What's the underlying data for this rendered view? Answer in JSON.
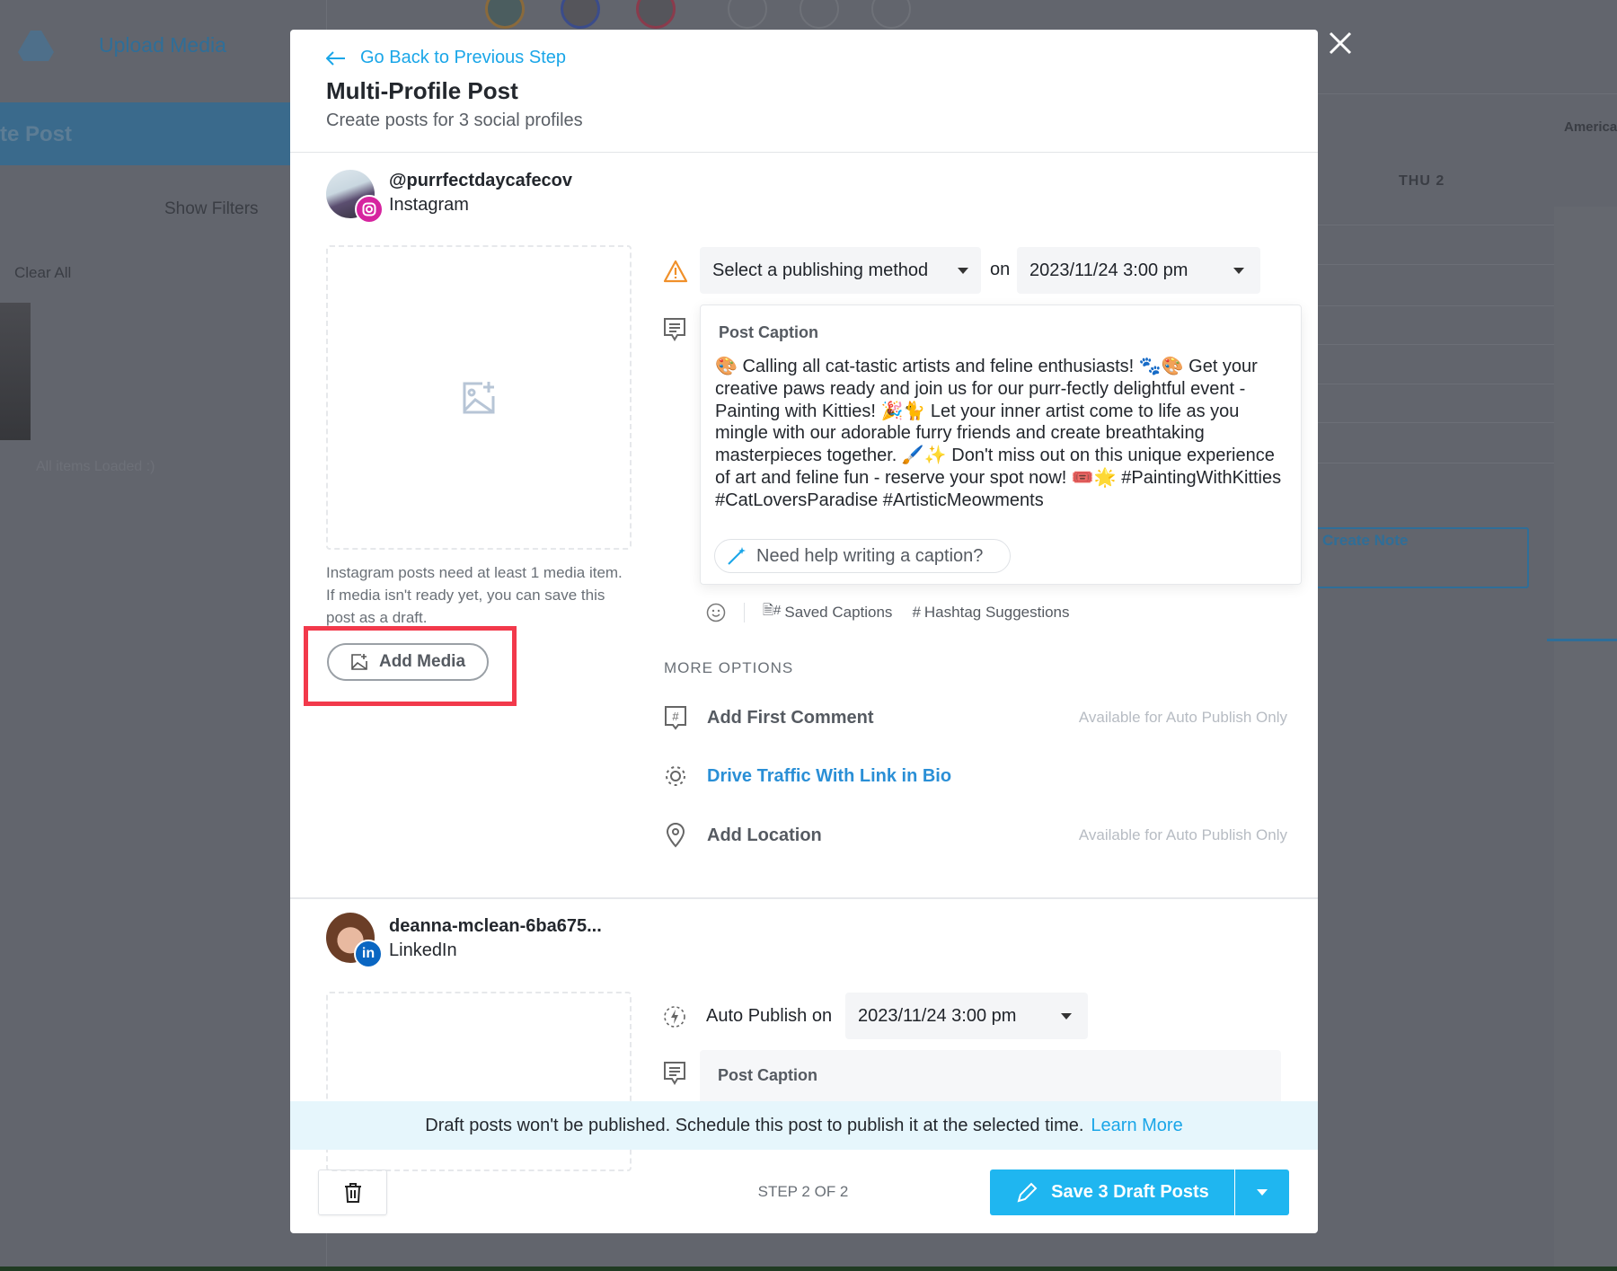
{
  "background": {
    "upload_media": "Upload Media",
    "create_post": "te Post",
    "show_filters": "Show Filters",
    "clear_all": "Clear All",
    "all_items_loaded": "All items Loaded :)",
    "day_header": "THU 2",
    "timezone": "America",
    "create_note": "Create Note"
  },
  "modal": {
    "back_link": "Go Back to Previous Step",
    "title": "Multi-Profile Post",
    "subtitle": "Create posts for 3 social profiles",
    "close_icon": "close-icon"
  },
  "profiles": [
    {
      "handle": "@purrfectdaycafecov",
      "network": "Instagram",
      "network_color": "#d6249f",
      "media_note": "Instagram posts need at least 1 media item. If media isn't ready yet, you can save this post as a draft.",
      "add_media": "Add Media",
      "publishing_method": "Select a publishing method",
      "on_label": "on",
      "datetime": "2023/11/24 3:00 pm",
      "caption_label": "Post Caption",
      "caption": "🎨 Calling all cat-tastic artists and feline enthusiasts! 🐾🎨 Get your creative paws ready and join us for our purr-fectly delightful event - Painting with Kitties! 🎉🐈 Let your inner artist come to life as you mingle with our adorable furry friends and create breathtaking masterpieces together. 🖌️✨ Don't miss out on this unique experience of art and feline fun - reserve your spot now! 🎟️🌟 #PaintingWithKitties #CatLoversParadise #ArtisticMeowments",
      "caption_help": "Need help writing a caption?",
      "saved_captions": "Saved Captions",
      "hashtag_suggestions": "Hashtag Suggestions",
      "more_options": "MORE OPTIONS",
      "options": [
        {
          "label": "Add First Comment",
          "note": "Available for Auto Publish Only"
        },
        {
          "label": "Drive Traffic With Link in Bio",
          "note": ""
        },
        {
          "label": "Add Location",
          "note": "Available for Auto Publish Only"
        }
      ]
    },
    {
      "handle": "deanna-mclean-6ba675...",
      "network": "LinkedIn",
      "network_color": "#0a66c2",
      "auto_publish_label": "Auto Publish on",
      "datetime": "2023/11/24 3:00 pm",
      "caption_label": "Post Caption"
    }
  ],
  "banner": {
    "text": "Draft posts won't be published. Schedule this post to publish it at the selected time.",
    "link": "Learn More"
  },
  "footer": {
    "step": "STEP 2 OF 2",
    "save": "Save 3 Draft Posts"
  },
  "colors": {
    "accent": "#1fb6f0",
    "highlight": "#f2394b",
    "banner_bg": "#e6f6fc"
  }
}
